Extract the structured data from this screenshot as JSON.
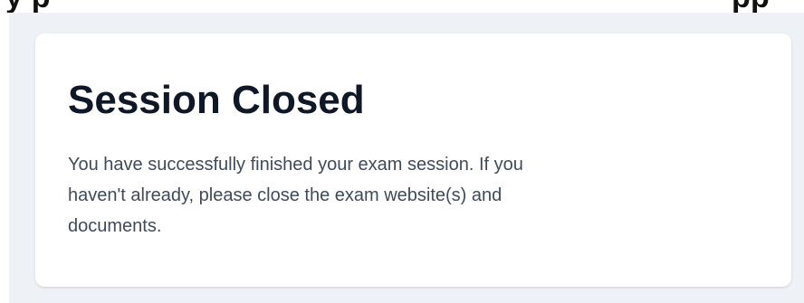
{
  "top_banner": {
    "left_text": "y p",
    "right_text": "pp"
  },
  "session_card": {
    "title": "Session Closed",
    "message_lines": [
      "You have successfully finished your exam session. If you",
      "haven't already, please close the exam website(s) and",
      "documents."
    ]
  },
  "colors": {
    "page_background": "#eef2f7",
    "card_background": "#ffffff",
    "title_text": "#101828",
    "body_text": "#3f4a5a"
  }
}
